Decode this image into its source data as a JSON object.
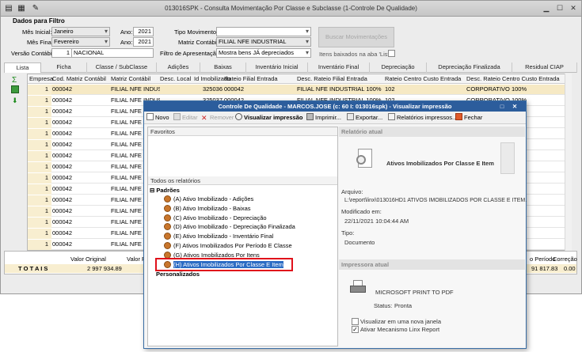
{
  "window": {
    "title": "013016SPK - Consulta Movimentação Por Classe e Subclasse (1-Controle De Qualidade)"
  },
  "filters": {
    "section_title": "Dados para Filtro",
    "mes_inicial_label": "Mês Inicial:",
    "mes_inicial_value": "Janeiro",
    "ano1_label": "Ano:",
    "ano1_value": "2021",
    "mes_final_label": "Mês Final:",
    "mes_final_value": "Fevereiro",
    "ano2_label": "Ano:",
    "ano2_value": "2021",
    "versao_label": "Versão Contábil:",
    "versao_num": "1",
    "versao_value": "NACIONAL",
    "tipo_mov_label": "Tipo Movimento:",
    "tipo_mov_value": "",
    "matriz_label": "Matriz Contábil:",
    "matriz_value": "FILIAL NFE INDUSTRIAL",
    "filtro_apres_label": "Filtro de Apresentação:",
    "filtro_apres_value": "Mostra bens JÁ depreciados",
    "itens_baixados_label": "Itens baixados na aba 'Lista'",
    "buscar_label": "Buscar Movimentações"
  },
  "tabs": [
    "Lista",
    "Ficha",
    "Classe / SubClasse",
    "Adições",
    "Baixas",
    "Inventário Inicial",
    "Inventário Final",
    "Depreciação",
    "Depreciação Finalizada",
    "Residual CIAP"
  ],
  "grid": {
    "headers": [
      "Empresa",
      "Cod. Matriz Contábil",
      "Matriz Contábil",
      "Desc. Local",
      "Id Imobilizado",
      "Rateio Filial Entrada",
      "Desc. Rateio Filial Entrada",
      "Rateio Centro Custo Entrada",
      "Desc. Rateio Centro Custo Entrada"
    ],
    "rows": [
      [
        "1",
        "000042",
        "FILIAL NFE INDUSTRIAL",
        "",
        "325036",
        "000042",
        "FILIAL NFE INDUSTRIAL 100%",
        "102",
        "CORPORATIVO 100%"
      ],
      [
        "1",
        "000042",
        "FILIAL NFE INDUSTRIAL",
        "",
        "325037",
        "000042",
        "FILIAL NFE INDUSTRIAL 100%",
        "102",
        "CORPORATIVO 100%"
      ],
      [
        "1",
        "000042",
        "FILIAL NFE INDUSTRIAL",
        "",
        "",
        "",
        "",
        "",
        ""
      ],
      [
        "1",
        "000042",
        "FILIAL NFE INDUSTRIAL",
        "",
        "",
        "",
        "",
        "",
        ""
      ],
      [
        "1",
        "000042",
        "FILIAL NFE INDUSTRIAL",
        "",
        "",
        "",
        "",
        "",
        ""
      ],
      [
        "1",
        "000042",
        "FILIAL NFE INDUSTRIAL",
        "",
        "",
        "",
        "",
        "",
        ""
      ],
      [
        "1",
        "000042",
        "FILIAL NFE INDUSTRIAL",
        "",
        "",
        "",
        "",
        "",
        ""
      ],
      [
        "1",
        "000042",
        "FILIAL NFE INDUSTRIAL",
        "",
        "",
        "",
        "",
        "",
        ""
      ],
      [
        "1",
        "000042",
        "FILIAL NFE INDUSTRIAL",
        "",
        "",
        "",
        "",
        "",
        ""
      ],
      [
        "1",
        "000042",
        "FILIAL NFE INDUSTRIAL",
        "",
        "",
        "",
        "",
        "",
        ""
      ],
      [
        "1",
        "000042",
        "FILIAL NFE INDUSTRIAL",
        "",
        "",
        "",
        "",
        "",
        ""
      ],
      [
        "1",
        "000042",
        "FILIAL NFE INDUSTRIAL",
        "",
        "",
        "",
        "",
        "",
        ""
      ],
      [
        "1",
        "000042",
        "FILIAL NFE INDUSTRIAL",
        "",
        "",
        "",
        "",
        "",
        ""
      ],
      [
        "1",
        "000042",
        "FILIAL NFE INDUSTRIAL",
        "",
        "",
        "",
        "",
        "",
        ""
      ],
      [
        "1",
        "000042",
        "FILIAL NFE INDUSTRIAL",
        "",
        "",
        "",
        "",
        "",
        ""
      ]
    ]
  },
  "totals": {
    "label": "T O T A I S",
    "valor_original_label": "Valor Original",
    "valor_original": "2 997 934.89",
    "valor_r_label": "Valor R",
    "periodo_label": "o Período",
    "periodo_value": "91 817.83",
    "correcao_label": "Correção",
    "correcao_value": "0.00"
  },
  "dialog": {
    "title": "Controle De Qualidade - MARCOS.JOSE (c: 60 I: 013016spk) - Visualizar impressão",
    "toolbar": {
      "novo": "Novo",
      "editar": "Editar",
      "remover": "Remover",
      "visualizar": "Visualizar impressão",
      "imprimir": "Imprimir...",
      "exportar": "Exportar...",
      "relatorios": "Relatórios impressos...",
      "fechar": "Fechar"
    },
    "favoritos": "Favoritos",
    "todos": "Todos os relatórios",
    "padroes": "Padrões",
    "reports": [
      "(A) Ativo Imobilizado - Adições",
      "(B) Ativo Imobilizado - Baixas",
      "(C) Ativo Imobilizado - Depreciação",
      "(D) Ativo Imobilizado - Depreciação Finalizada",
      "(E) Ativo Imobilizado - Inventário Final",
      "(F) Ativos Imobilizados Por Período E Classe",
      "(G) Ativos Imobilizados Por Itens",
      "(H) Ativos Imobilizados Por Classe E Item"
    ],
    "personalizados": "Personalizados",
    "relatorio_atual": "Relatório atual",
    "report_name": "Ativos Imobilizados Por Classe E Item",
    "arquivo_label": "Arquivo:",
    "arquivo_value": "L:\\report\\linx\\013016HD1 ATIVOS IMOBILIZADOS POR CLASSE E ITEM.",
    "modificado_label": "Modificado em:",
    "modificado_value": "22/11/2021 10:04:44 AM",
    "tipo_label": "Tipo:",
    "tipo_value": "Documento",
    "impressora_atual": "Impressora atual",
    "printer_name": "MICROSOFT PRINT TO PDF",
    "status_label": "Status:",
    "status_value": "Pronta",
    "chk_nova_janela": "Visualizar em uma nova janela",
    "chk_mecanismo": "Ativar Mecanismo Linx Report"
  }
}
